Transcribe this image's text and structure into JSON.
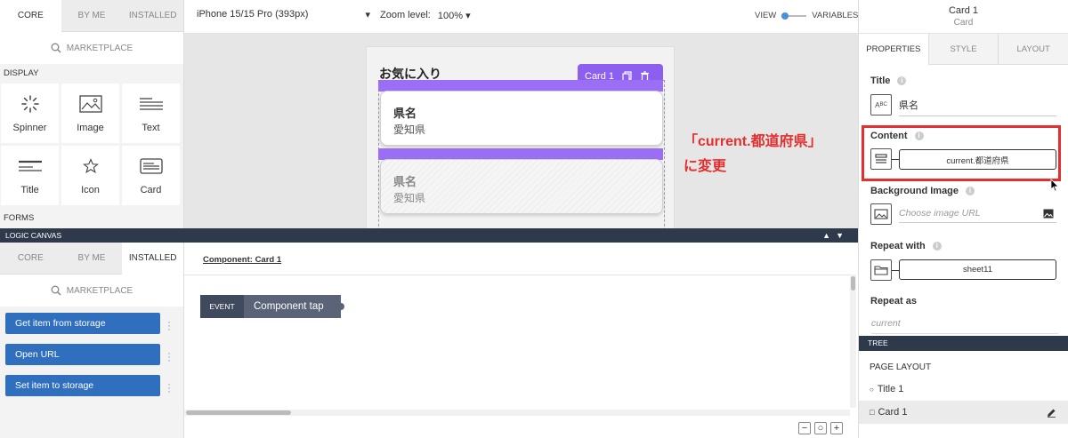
{
  "palette": {
    "tabs": [
      "CORE",
      "BY ME",
      "INSTALLED"
    ],
    "marketplace": "MARKETPLACE",
    "display_label": "DISPLAY",
    "forms_label": "FORMS",
    "tiles": [
      {
        "label": "Spinner",
        "icon": "spinner-icon"
      },
      {
        "label": "Image",
        "icon": "image-icon"
      },
      {
        "label": "Text",
        "icon": "text-icon"
      },
      {
        "label": "Title",
        "icon": "title-icon"
      },
      {
        "label": "Icon",
        "icon": "star-icon"
      },
      {
        "label": "Card",
        "icon": "card-icon"
      }
    ]
  },
  "topbar": {
    "device": "iPhone 15/15 Pro (393px)",
    "zoom_label": "Zoom level:",
    "zoom_value": "100%",
    "view_label": "VIEW",
    "variables_label": "VARIABLES",
    "selection_name": "Card 1",
    "selection_type": "Card"
  },
  "canvas": {
    "page_title": "お気に入り",
    "card_toolbar_label": "Card 1",
    "cards": [
      {
        "title": "県名",
        "subtitle": "愛知県"
      },
      {
        "title": "県名",
        "subtitle": "愛知県"
      }
    ]
  },
  "annotation": {
    "line1": "「current.都道府県」",
    "line2": "に変更"
  },
  "properties": {
    "tabs": [
      "PROPERTIES",
      "STYLE",
      "LAYOUT"
    ],
    "title_label": "Title",
    "title_value": "県名",
    "content_label": "Content",
    "content_value": "current.都道府県",
    "bg_label": "Background Image",
    "bg_placeholder": "Choose image URL",
    "repeat_label": "Repeat with",
    "repeat_value": "sheet11",
    "repeat_as_label": "Repeat as",
    "repeat_as_value": "current"
  },
  "logic": {
    "bar_label": "LOGIC CANVAS",
    "tabs": [
      "CORE",
      "BY ME",
      "INSTALLED"
    ],
    "marketplace": "MARKETPLACE",
    "actions": [
      "Get item from storage",
      "Open URL",
      "Set item to storage"
    ],
    "component_tab": "Component: Card 1",
    "event_tag": "EVENT",
    "event_name": "Component tap"
  },
  "tree": {
    "header": "TREE",
    "page_layout": "PAGE LAYOUT",
    "items": [
      {
        "label": "Title 1",
        "marker": "○"
      },
      {
        "label": "Card 1",
        "marker": "□"
      }
    ]
  },
  "colors": {
    "accent_blue": "#2f6fbd",
    "selection_purple": "#8c5ff0",
    "annotation_red": "#e52e2e",
    "dark_bar": "#2e3a4c"
  }
}
